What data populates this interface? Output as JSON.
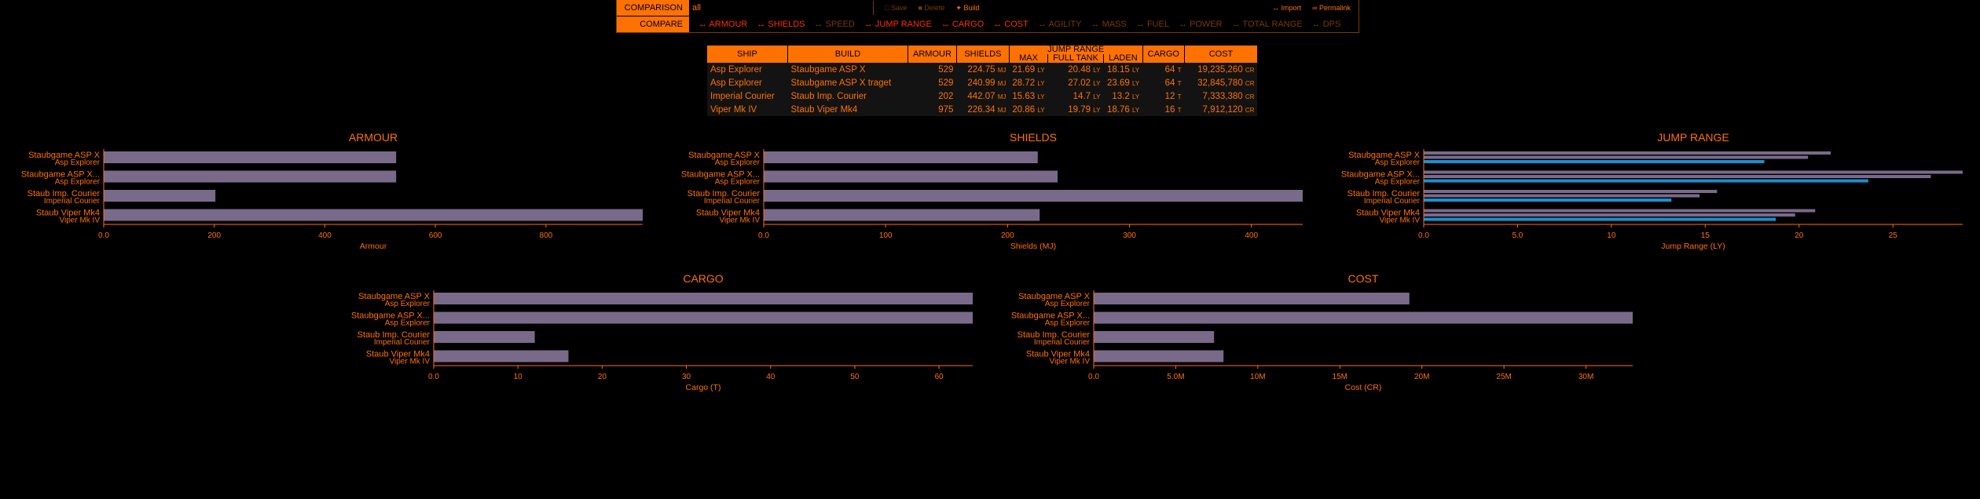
{
  "compare_panel": {
    "comparison_label": "COMPARISON",
    "comparison_value": "all",
    "compare_label": "COMPARE",
    "tools": [
      "Save",
      "Delete",
      "Build"
    ],
    "tools_right": [
      "Import",
      "Permalink"
    ],
    "options": [
      {
        "label": "ARMOUR",
        "on": true
      },
      {
        "label": "SHIELDS",
        "on": true
      },
      {
        "label": "SPEED",
        "on": false
      },
      {
        "label": "JUMP RANGE",
        "on": true
      },
      {
        "label": "CARGO",
        "on": true
      },
      {
        "label": "COST",
        "on": true
      },
      {
        "label": "AGILITY",
        "on": false
      },
      {
        "label": "MASS",
        "on": false
      },
      {
        "label": "FUEL",
        "on": false
      },
      {
        "label": "POWER",
        "on": false
      },
      {
        "label": "TOTAL RANGE",
        "on": false
      },
      {
        "label": "DPS",
        "on": false
      }
    ],
    "colors": {
      "accent": "#ff7100",
      "active": "#ff2f00",
      "inactive": "#7a3a00"
    }
  },
  "table": {
    "headers": {
      "ship": "SHIP",
      "build": "BUILD",
      "armour": "ARMOUR",
      "shields": "SHIELDS",
      "jump_range": "JUMP RANGE",
      "max": "MAX",
      "full_tank": "FULL TANK",
      "laden": "LADEN",
      "cargo": "CARGO",
      "cost": "COST"
    },
    "units": {
      "mj": "MJ",
      "ly": "LY",
      "t": "T",
      "cr": "CR"
    },
    "rows": [
      {
        "ship": "Asp Explorer",
        "build": "Staubgame ASP X",
        "armour": "529",
        "shields": "224.75",
        "max": "21.69",
        "full_tank": "20.48",
        "laden": "18.15",
        "cargo": "64",
        "cost": "19,235,260"
      },
      {
        "ship": "Asp Explorer",
        "build": "Staubgame ASP X traget",
        "armour": "529",
        "shields": "240.99",
        "max": "28.72",
        "full_tank": "27.02",
        "laden": "23.69",
        "cargo": "64",
        "cost": "32,845,780"
      },
      {
        "ship": "Imperial Courier",
        "build": "Staub Imp. Courier",
        "armour": "202",
        "shields": "442.07",
        "max": "15.63",
        "full_tank": "14.7",
        "laden": "13.2",
        "cargo": "12",
        "cost": "7,333,380"
      },
      {
        "ship": "Viper Mk IV",
        "build": "Staub Viper Mk4",
        "armour": "975",
        "shields": "226.34",
        "max": "20.86",
        "full_tank": "19.79",
        "laden": "18.76",
        "cargo": "16",
        "cost": "7,912,120"
      }
    ]
  },
  "chart_data": [
    {
      "type": "bar",
      "title": "ARMOUR",
      "xlabel": "Armour",
      "categories": [
        {
          "build": "Staubgame ASP X",
          "ship": "Asp Explorer"
        },
        {
          "build": "Staubgame ASP X...",
          "ship": "Asp Explorer"
        },
        {
          "build": "Staub Imp. Courier",
          "ship": "Imperial Courier"
        },
        {
          "build": "Staub Viper Mk4",
          "ship": "Viper Mk IV"
        }
      ],
      "series": [
        {
          "values": [
            529,
            529,
            202,
            975
          ],
          "color": "#7a6a8a"
        }
      ],
      "xlim": [
        0,
        975
      ],
      "ticks": [
        {
          "v": 0,
          "label": "0.0"
        },
        {
          "v": 200,
          "label": "200"
        },
        {
          "v": 400,
          "label": "400"
        },
        {
          "v": 600,
          "label": "600"
        },
        {
          "v": 800,
          "label": "800"
        }
      ]
    },
    {
      "type": "bar",
      "title": "SHIELDS",
      "xlabel": "Shields (MJ)",
      "categories": [
        {
          "build": "Staubgame ASP X",
          "ship": "Asp Explorer"
        },
        {
          "build": "Staubgame ASP X...",
          "ship": "Asp Explorer"
        },
        {
          "build": "Staub Imp. Courier",
          "ship": "Imperial Courier"
        },
        {
          "build": "Staub Viper Mk4",
          "ship": "Viper Mk IV"
        }
      ],
      "series": [
        {
          "values": [
            224.75,
            240.99,
            442.07,
            226.34
          ],
          "color": "#7a6a8a"
        }
      ],
      "xlim": [
        0,
        442.07
      ],
      "ticks": [
        {
          "v": 0,
          "label": "0.0"
        },
        {
          "v": 100,
          "label": "100"
        },
        {
          "v": 200,
          "label": "200"
        },
        {
          "v": 300,
          "label": "300"
        },
        {
          "v": 400,
          "label": "400"
        }
      ]
    },
    {
      "type": "bar",
      "title": "JUMP RANGE",
      "xlabel": "Jump Range (LY)",
      "categories": [
        {
          "build": "Staubgame ASP X",
          "ship": "Asp Explorer"
        },
        {
          "build": "Staubgame ASP X...",
          "ship": "Asp Explorer"
        },
        {
          "build": "Staub Imp. Courier",
          "ship": "Imperial Courier"
        },
        {
          "build": "Staub Viper Mk4",
          "ship": "Viper Mk IV"
        }
      ],
      "series": [
        {
          "values": [
            21.69,
            28.72,
            15.63,
            20.86
          ],
          "color": "#7a6a8a"
        },
        {
          "values": [
            20.48,
            27.02,
            14.7,
            19.79
          ],
          "color": "#7a6a8a"
        },
        {
          "values": [
            18.15,
            23.69,
            13.2,
            18.76
          ],
          "color": "#1a90d0"
        }
      ],
      "xlim": [
        0,
        28.72
      ],
      "ticks": [
        {
          "v": 0,
          "label": "0.0"
        },
        {
          "v": 5,
          "label": "5.0"
        },
        {
          "v": 10,
          "label": "10"
        },
        {
          "v": 15,
          "label": "15"
        },
        {
          "v": 20,
          "label": "20"
        },
        {
          "v": 25,
          "label": "25"
        }
      ]
    },
    {
      "type": "bar",
      "title": "CARGO",
      "xlabel": "Cargo (T)",
      "categories": [
        {
          "build": "Staubgame ASP X",
          "ship": "Asp Explorer"
        },
        {
          "build": "Staubgame ASP X...",
          "ship": "Asp Explorer"
        },
        {
          "build": "Staub Imp. Courier",
          "ship": "Imperial Courier"
        },
        {
          "build": "Staub Viper Mk4",
          "ship": "Viper Mk IV"
        }
      ],
      "series": [
        {
          "values": [
            64,
            64,
            12,
            16
          ],
          "color": "#7a6a8a"
        }
      ],
      "xlim": [
        0,
        64
      ],
      "ticks": [
        {
          "v": 0,
          "label": "0.0"
        },
        {
          "v": 10,
          "label": "10"
        },
        {
          "v": 20,
          "label": "20"
        },
        {
          "v": 30,
          "label": "30"
        },
        {
          "v": 40,
          "label": "40"
        },
        {
          "v": 50,
          "label": "50"
        },
        {
          "v": 60,
          "label": "60"
        }
      ]
    },
    {
      "type": "bar",
      "title": "COST",
      "xlabel": "Cost (CR)",
      "categories": [
        {
          "build": "Staubgame ASP X",
          "ship": "Asp Explorer"
        },
        {
          "build": "Staubgame ASP X...",
          "ship": "Asp Explorer"
        },
        {
          "build": "Staub Imp. Courier",
          "ship": "Imperial Courier"
        },
        {
          "build": "Staub Viper Mk4",
          "ship": "Viper Mk IV"
        }
      ],
      "series": [
        {
          "values": [
            19235260,
            32845780,
            7333380,
            7912120
          ],
          "color": "#7a6a8a"
        }
      ],
      "xlim": [
        0,
        32845780
      ],
      "ticks": [
        {
          "v": 0,
          "label": "0.0"
        },
        {
          "v": 5000000,
          "label": "5.0M"
        },
        {
          "v": 10000000,
          "label": "10M"
        },
        {
          "v": 15000000,
          "label": "15M"
        },
        {
          "v": 20000000,
          "label": "20M"
        },
        {
          "v": 25000000,
          "label": "25M"
        },
        {
          "v": 30000000,
          "label": "30M"
        }
      ]
    }
  ]
}
